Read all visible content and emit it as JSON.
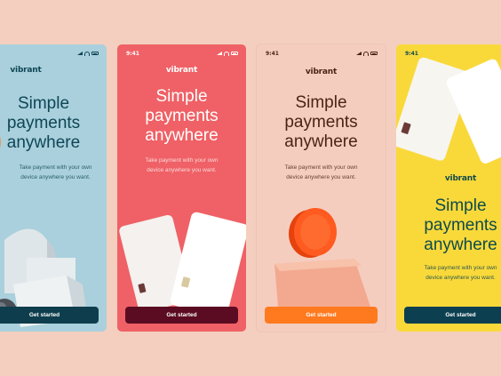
{
  "background_color": "#f4cfbf",
  "status_bar": {
    "time": "9:41",
    "icons": [
      "signal-icon",
      "wifi-icon",
      "battery-icon"
    ]
  },
  "screens": [
    {
      "logo": "vibrant",
      "title_lines": [
        "Simple",
        "payments",
        "anywhere"
      ],
      "subtitle_lines": [
        "Take payment with your own",
        "device anywhere you want."
      ],
      "cta": "Get started",
      "bg": "#a9d0dc",
      "cta_color": "#0e3e4d"
    },
    {
      "logo": "vibrant",
      "title_lines": [
        "Simple",
        "payments",
        "anywhere"
      ],
      "subtitle_lines": [
        "Take payment with your own",
        "device anywhere you want."
      ],
      "cta": "Get started",
      "bg": "#ef6166",
      "cta_color": "#5b0c22"
    },
    {
      "logo": "vibrant",
      "title_lines": [
        "Simple",
        "payments",
        "anywhere"
      ],
      "subtitle_lines": [
        "Take payment with your own",
        "device anywhere you want."
      ],
      "cta": "Get started",
      "bg": "#f5cdbf",
      "cta_color": "#ff7a1f"
    },
    {
      "logo": "vibrant",
      "title_lines": [
        "Simple",
        "payments",
        "anywhere"
      ],
      "subtitle_lines": [
        "Take payment with your own",
        "device anywhere you want."
      ],
      "cta": "Get started",
      "bg": "#f9d93a",
      "cta_color": "#0c4050"
    }
  ]
}
